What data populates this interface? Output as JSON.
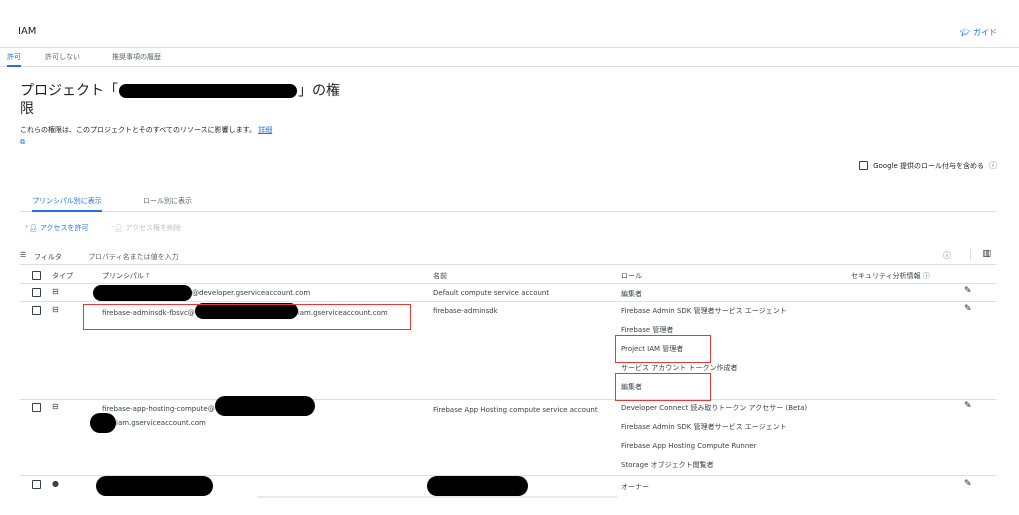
{
  "header": {
    "title": "IAM",
    "guide_label": "ガイド"
  },
  "tabs": [
    "許可",
    "許可しない",
    "推奨事項の履歴"
  ],
  "heading": {
    "part1": "プロジェクト「",
    "part2": "」の権",
    "part3": "限",
    "description": "これらの権限は、このプロジェクトとそのすべてのリソースに影響します。",
    "link": "詳細"
  },
  "google_roles_label": "Google 提供のロール付与を含める",
  "view_tabs": [
    "プリンシパル別に表示",
    "ロール別に表示"
  ],
  "actions": {
    "grant": "アクセスを許可",
    "remove": "アクセス権を削除"
  },
  "filter": {
    "label": "フィルタ",
    "placeholder": "プロパティ名または値を入力"
  },
  "columns": {
    "type": "タイプ",
    "principal": "プリンシパル",
    "name": "名前",
    "role": "ロール",
    "security": "セキュリティ分析情報"
  },
  "rows": [
    {
      "principal_suffix": "@developer.gserviceaccount.com",
      "name": "Default compute service account",
      "roles": [
        "編集者"
      ]
    },
    {
      "principal_prefix": "firebase-adminsdk-fbsvc@",
      "principal_suffix": "iam.gserviceaccount.com",
      "name": "firebase-adminsdk",
      "roles": [
        "Firebase Admin SDK 管理者サービス エージェント",
        "Firebase 管理者",
        "Project IAM 管理者",
        "サービス アカウント トークン作成者",
        "編集者"
      ]
    },
    {
      "principal_prefix": "firebase-app-hosting-compute@",
      "principal_suffix": "iam.gserviceaccount.com",
      "name": "Firebase App Hosting compute service account",
      "roles": [
        "Developer Connect 読み取りトークン アクセサー (Beta)",
        "Firebase Admin SDK 管理者サービス エージェント",
        "Firebase App Hosting Compute Runner",
        "Storage オブジェクト閲覧者"
      ]
    },
    {
      "roles": [
        "オーナー"
      ]
    }
  ],
  "colors": {
    "accent": "#1a73e8",
    "highlight": "#e53935",
    "redaction": "#000000"
  },
  "icons": [
    "school-icon",
    "add-person-icon",
    "remove-person-icon",
    "filter-icon",
    "help-icon",
    "columns-icon",
    "service-account-icon",
    "person-icon",
    "edit-icon",
    "sort-arrow-up-icon",
    "external-link-icon"
  ]
}
